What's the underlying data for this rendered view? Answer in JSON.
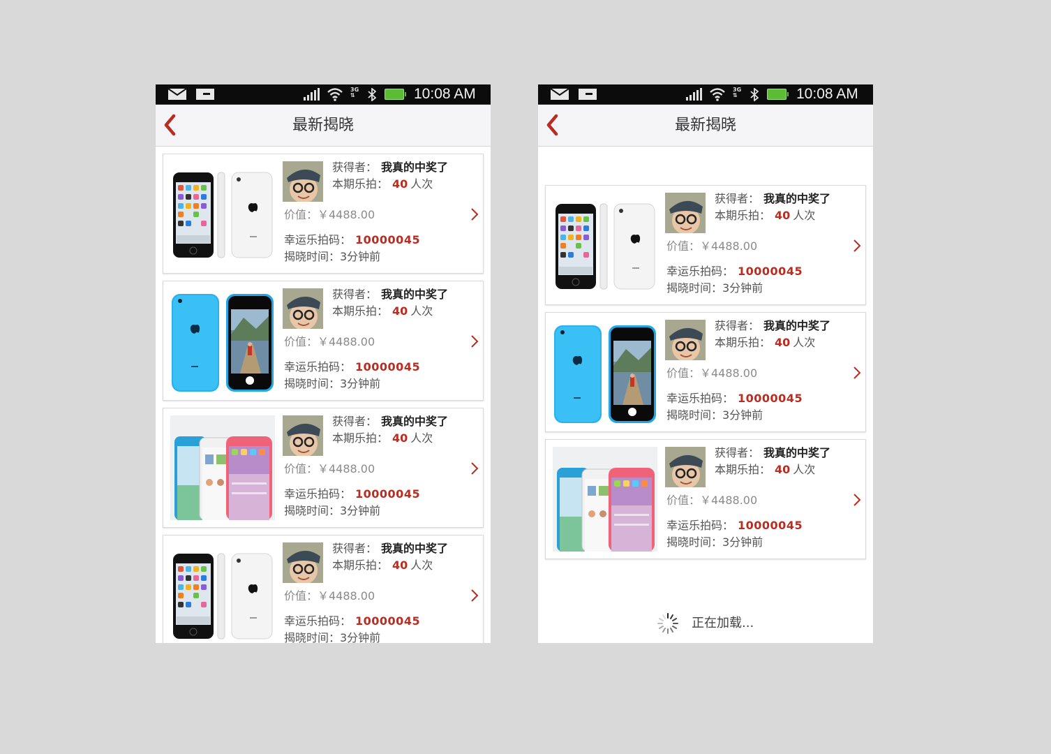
{
  "phones": [
    {
      "status_time": "10:08 AM",
      "title": "最新揭晓",
      "cards": [
        {
          "product_image": "iphone-5c-white",
          "winner_label": "获得者：",
          "winner_name": "我真的中奖了",
          "times_label": "本期乐拍：",
          "times_value": "40",
          "times_unit": "人次",
          "value_text": "价值：￥4488.00",
          "code_label": "幸运乐拍码：",
          "code_value": "10000045",
          "time_text": "揭晓时间：3分钟前"
        },
        {
          "product_image": "iphone-5c-blue",
          "winner_label": "获得者：",
          "winner_name": "我真的中奖了",
          "times_label": "本期乐拍：",
          "times_value": "40",
          "times_unit": "人次",
          "value_text": "价值：￥4488.00",
          "code_label": "幸运乐拍码：",
          "code_value": "10000045",
          "time_text": "揭晓时间：3分钟前"
        },
        {
          "product_image": "iphone-5c-lineup",
          "winner_label": "获得者：",
          "winner_name": "我真的中奖了",
          "times_label": "本期乐拍：",
          "times_value": "40",
          "times_unit": "人次",
          "value_text": "价值：￥4488.00",
          "code_label": "幸运乐拍码：",
          "code_value": "10000045",
          "time_text": "揭晓时间：3分钟前"
        },
        {
          "product_image": "iphone-5c-white",
          "winner_label": "获得者：",
          "winner_name": "我真的中奖了",
          "times_label": "本期乐拍：",
          "times_value": "40",
          "times_unit": "人次",
          "value_text": "价值：￥4488.00",
          "code_label": "幸运乐拍码：",
          "code_value": "10000045",
          "time_text": "揭晓时间：3分钟前"
        }
      ]
    },
    {
      "status_time": "10:08 AM",
      "title": "最新揭晓",
      "cards": [
        {
          "product_image": "iphone-5c-white",
          "winner_label": "获得者：",
          "winner_name": "我真的中奖了",
          "times_label": "本期乐拍：",
          "times_value": "40",
          "times_unit": "人次",
          "value_text": "价值：￥4488.00",
          "code_label": "幸运乐拍码：",
          "code_value": "10000045",
          "time_text": "揭晓时间：3分钟前"
        },
        {
          "product_image": "iphone-5c-blue",
          "winner_label": "获得者：",
          "winner_name": "我真的中奖了",
          "times_label": "本期乐拍：",
          "times_value": "40",
          "times_unit": "人次",
          "value_text": "价值：￥4488.00",
          "code_label": "幸运乐拍码：",
          "code_value": "10000045",
          "time_text": "揭晓时间：3分钟前"
        },
        {
          "product_image": "iphone-5c-lineup",
          "winner_label": "获得者：",
          "winner_name": "我真的中奖了",
          "times_label": "本期乐拍：",
          "times_value": "40",
          "times_unit": "人次",
          "value_text": "价值：￥4488.00",
          "code_label": "幸运乐拍码：",
          "code_value": "10000045",
          "time_text": "揭晓时间：3分钟前"
        }
      ],
      "loading_text": "正在加载..."
    }
  ],
  "icons": {
    "back": "chevron-left-icon",
    "row": "chevron-right-icon",
    "status": [
      "mail-icon",
      "sd-card-icon",
      "signal-icon",
      "wifi-icon",
      "3g-data-icon",
      "bluetooth-icon",
      "battery-icon"
    ],
    "loading": "spinner-icon"
  },
  "colors": {
    "accent": "#b82c21",
    "page_bg": "#d9d9d9",
    "status_bar": "#0c0c0c",
    "battery": "#5cbc34"
  }
}
